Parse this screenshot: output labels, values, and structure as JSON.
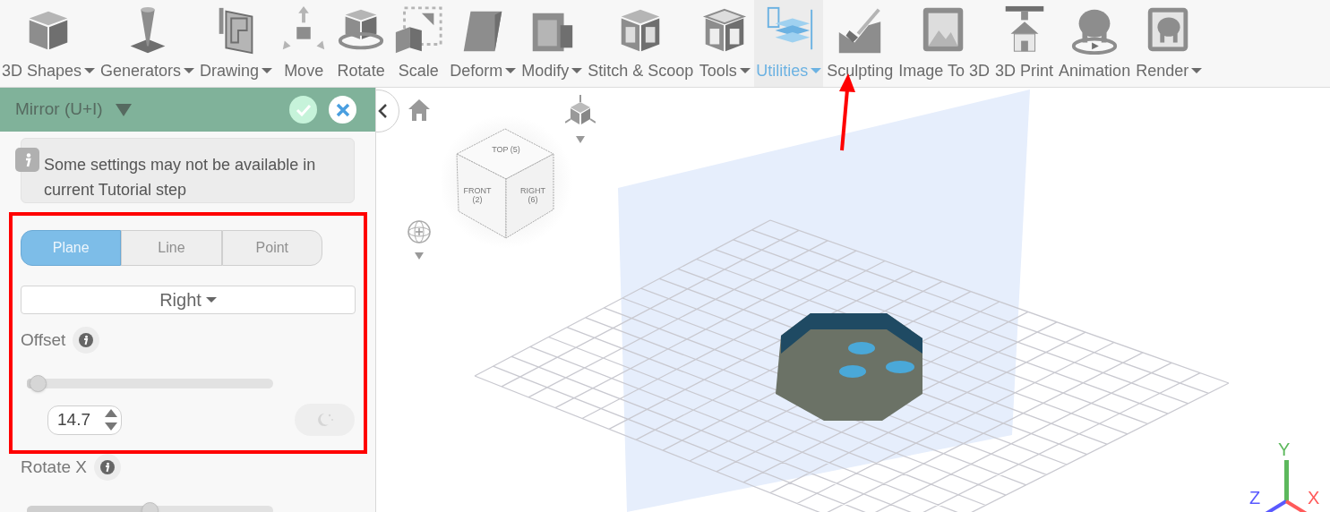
{
  "toolbar": {
    "items": [
      {
        "label": "3D Shapes",
        "has_menu": true,
        "selected": false
      },
      {
        "label": "Generators",
        "has_menu": true,
        "selected": false
      },
      {
        "label": "Drawing",
        "has_menu": true,
        "selected": false
      },
      {
        "label": "Move",
        "has_menu": false,
        "selected": false
      },
      {
        "label": "Rotate",
        "has_menu": false,
        "selected": false
      },
      {
        "label": "Scale",
        "has_menu": false,
        "selected": false
      },
      {
        "label": "Deform",
        "has_menu": true,
        "selected": false
      },
      {
        "label": "Modify",
        "has_menu": true,
        "selected": false
      },
      {
        "label": "Stitch & Scoop",
        "has_menu": false,
        "selected": false
      },
      {
        "label": "Tools",
        "has_menu": true,
        "selected": false
      },
      {
        "label": "Utilities",
        "has_menu": true,
        "selected": true
      },
      {
        "label": "Sculpting",
        "has_menu": false,
        "selected": false
      },
      {
        "label": "Image To 3D",
        "has_menu": false,
        "selected": false
      },
      {
        "label": "3D Print",
        "has_menu": false,
        "selected": false
      },
      {
        "label": "Animation",
        "has_menu": false,
        "selected": false
      },
      {
        "label": "Render",
        "has_menu": true,
        "selected": false
      }
    ]
  },
  "panel": {
    "title": "Mirror (U+I)",
    "notice": "Some settings may not be available in current Tutorial step",
    "modes": [
      {
        "label": "Plane",
        "selected": true
      },
      {
        "label": "Line",
        "selected": false
      },
      {
        "label": "Point",
        "selected": false
      }
    ],
    "orientation": "Right",
    "offset": {
      "label": "Offset",
      "level": 0.03,
      "value": "14.7"
    },
    "rotate_x": {
      "label": "Rotate X",
      "level": 0.5
    }
  },
  "view_cube": {
    "faces": [
      "TOP (5)",
      "FRONT (2)",
      "RIGHT (6)"
    ]
  },
  "axes": [
    {
      "label": "Y",
      "color": "#5cb85c"
    },
    {
      "label": "Z",
      "color": "#5a5aff"
    },
    {
      "label": "X",
      "color": "#ff5a5a"
    }
  ]
}
